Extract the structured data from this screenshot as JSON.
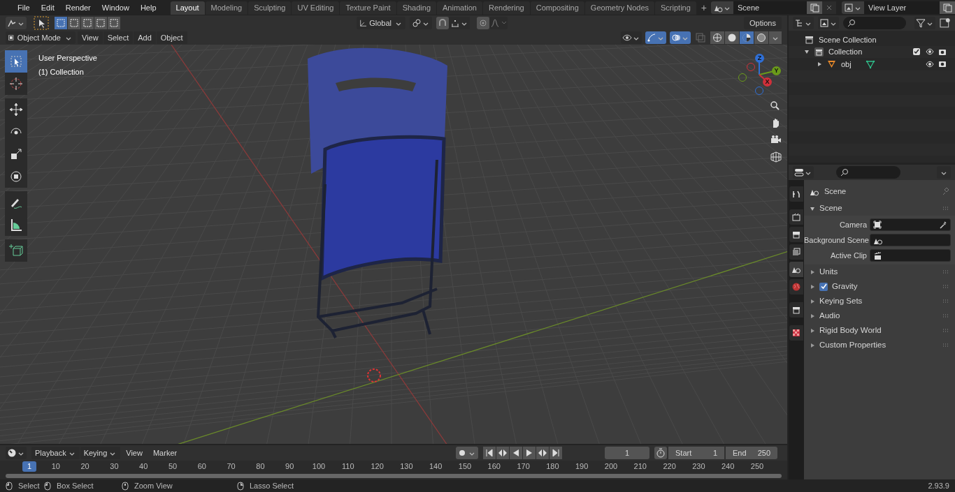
{
  "top_bar": {
    "menus": [
      "File",
      "Edit",
      "Render",
      "Window",
      "Help"
    ],
    "workspaces": [
      {
        "label": "Layout",
        "selected": true
      },
      {
        "label": "Modeling",
        "selected": false
      },
      {
        "label": "Sculpting",
        "selected": false
      },
      {
        "label": "UV Editing",
        "selected": false
      },
      {
        "label": "Texture Paint",
        "selected": false
      },
      {
        "label": "Shading",
        "selected": false
      },
      {
        "label": "Animation",
        "selected": false
      },
      {
        "label": "Rendering",
        "selected": false
      },
      {
        "label": "Compositing",
        "selected": false
      },
      {
        "label": "Geometry Nodes",
        "selected": false
      },
      {
        "label": "Scripting",
        "selected": false
      }
    ],
    "add_workspace": "+",
    "scene": "Scene",
    "view_layer": "View Layer"
  },
  "tool_header": {
    "select_modes": [
      {
        "selected": true
      },
      {
        "selected": false
      },
      {
        "selected": false
      },
      {
        "selected": false
      },
      {
        "selected": false
      }
    ],
    "orientation": "Global",
    "options": "Options"
  },
  "view_header": {
    "mode": "Object Mode",
    "menus": [
      "View",
      "Select",
      "Add",
      "Object"
    ],
    "shading": [
      {
        "kind": "wireframe",
        "selected": false
      },
      {
        "kind": "solid",
        "selected": false
      },
      {
        "kind": "material",
        "selected": true
      },
      {
        "kind": "rendered",
        "selected": false
      }
    ]
  },
  "viewport": {
    "overlay_lines": [
      "User Perspective",
      "(1) Collection"
    ],
    "gizmo_axes": [
      {
        "label": "Z",
        "kind": "z"
      },
      {
        "label": "Y",
        "kind": "y"
      },
      {
        "label": "X",
        "kind": "x"
      }
    ],
    "tools": [
      {
        "kind": "select",
        "selected": true
      },
      {
        "kind": "cursor",
        "selected": false
      },
      {
        "kind": "move",
        "selected": false
      },
      {
        "kind": "rotate",
        "selected": false
      },
      {
        "kind": "scale",
        "selected": false
      },
      {
        "kind": "transform",
        "selected": false
      },
      {
        "kind": "annotate",
        "selected": false
      },
      {
        "kind": "measure",
        "selected": false
      },
      {
        "kind": "add-cube",
        "selected": false
      }
    ]
  },
  "outliner": {
    "items": [
      {
        "label": "Scene Collection",
        "kind": "scene-collection",
        "children": [
          {
            "label": "Collection",
            "kind": "collection",
            "expanded": true,
            "checked": true,
            "children": [
              {
                "label": "obj",
                "kind": "mesh-object",
                "expanded": false
              }
            ]
          }
        ]
      }
    ]
  },
  "properties": {
    "tabs": [
      {
        "kind": "tool",
        "selected": false
      },
      {
        "kind": "render",
        "selected": false
      },
      {
        "kind": "output",
        "selected": false
      },
      {
        "kind": "view-layer",
        "selected": false
      },
      {
        "kind": "scene",
        "selected": true
      },
      {
        "kind": "world",
        "selected": false
      },
      {
        "kind": "collection",
        "selected": false
      },
      {
        "kind": "texture",
        "selected": false
      }
    ],
    "context": "Scene",
    "panel": {
      "title": "Scene",
      "expanded": true,
      "fields": [
        {
          "label": "Camera",
          "kind": "camera"
        },
        {
          "label": "Background Scene",
          "kind": "scene"
        },
        {
          "label": "Active Clip",
          "kind": "clip"
        }
      ]
    },
    "subpanels": [
      {
        "label": "Units",
        "kind": "plain"
      },
      {
        "label": "Gravity",
        "kind": "toggle",
        "checked": true
      },
      {
        "label": "Keying Sets",
        "kind": "plain"
      },
      {
        "label": "Audio",
        "kind": "plain"
      },
      {
        "label": "Rigid Body World",
        "kind": "plain"
      },
      {
        "label": "Custom Properties",
        "kind": "plain"
      }
    ]
  },
  "timeline": {
    "menus": [
      "Playback",
      "Keying",
      "View",
      "Marker"
    ],
    "current_frame": "1",
    "start_label": "Start",
    "start": "1",
    "end_label": "End",
    "end": "250",
    "ruler": [
      {
        "label": "1",
        "selected": true
      },
      {
        "label": "10",
        "selected": false
      },
      {
        "label": "20",
        "selected": false
      },
      {
        "label": "30",
        "selected": false
      },
      {
        "label": "40",
        "selected": false
      },
      {
        "label": "50",
        "selected": false
      },
      {
        "label": "60",
        "selected": false
      },
      {
        "label": "70",
        "selected": false
      },
      {
        "label": "80",
        "selected": false
      },
      {
        "label": "90",
        "selected": false
      },
      {
        "label": "100",
        "selected": false
      },
      {
        "label": "110",
        "selected": false
      },
      {
        "label": "120",
        "selected": false
      },
      {
        "label": "130",
        "selected": false
      },
      {
        "label": "140",
        "selected": false
      },
      {
        "label": "150",
        "selected": false
      },
      {
        "label": "160",
        "selected": false
      },
      {
        "label": "170",
        "selected": false
      },
      {
        "label": "180",
        "selected": false
      },
      {
        "label": "190",
        "selected": false
      },
      {
        "label": "200",
        "selected": false
      },
      {
        "label": "210",
        "selected": false
      },
      {
        "label": "220",
        "selected": false
      },
      {
        "label": "230",
        "selected": false
      },
      {
        "label": "240",
        "selected": false
      },
      {
        "label": "250",
        "selected": false
      }
    ]
  },
  "status_bar": {
    "hints": [
      {
        "kind": "left-mouse",
        "label": "Select"
      },
      {
        "kind": "left-drag",
        "label": "Box Select"
      },
      {
        "kind": "middle-mouse",
        "label": "Zoom View"
      },
      {
        "kind": "right-drag",
        "label": "Lasso Select"
      }
    ],
    "version": "2.93.9"
  }
}
